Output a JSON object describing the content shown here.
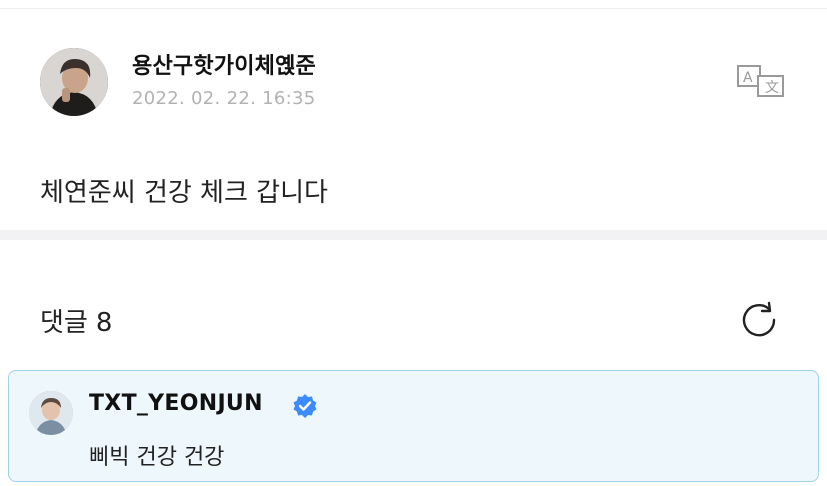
{
  "post": {
    "author": "용산구핫가이체옍준",
    "date": "2022. 02. 22. 16:35",
    "body": "체연준씨 건강 체크 갑니다",
    "translate_icon": "translate-icon"
  },
  "comments": {
    "label": "댓글",
    "count": "8",
    "refresh_icon": "refresh-icon",
    "items": [
      {
        "author": "TXT_YEONJUN",
        "verified": true,
        "text": "삐빅 건강 건강"
      }
    ]
  },
  "colors": {
    "accent_blue": "#3d8bff",
    "highlight_bg": "#eef8fc",
    "highlight_border": "#9ed2e6",
    "muted_text": "#b2b2b2"
  }
}
